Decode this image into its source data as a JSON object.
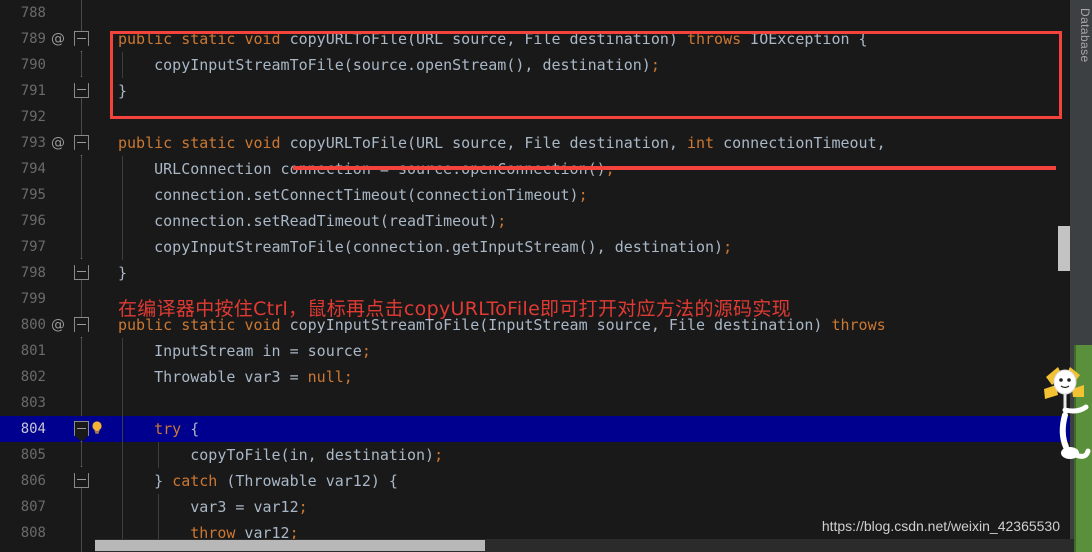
{
  "editor": {
    "app_kind": "java-source-viewer",
    "current_line": 804,
    "lines": [
      {
        "num": "788",
        "annotation": "",
        "fold": "",
        "indent_guides": 0,
        "tokens": []
      },
      {
        "num": "789",
        "annotation": "@",
        "fold": "down",
        "indent_guides": 0,
        "tokens": [
          {
            "t": "public",
            "c": "k"
          },
          {
            "t": " ",
            "c": "plain"
          },
          {
            "t": "static",
            "c": "k"
          },
          {
            "t": " ",
            "c": "plain"
          },
          {
            "t": "void",
            "c": "k"
          },
          {
            "t": " ",
            "c": "plain"
          },
          {
            "t": "copyURLToFile(URL source, File destination) ",
            "c": "id"
          },
          {
            "t": "throws",
            "c": "k"
          },
          {
            "t": " ",
            "c": "plain"
          },
          {
            "t": "IOException {",
            "c": "id"
          }
        ]
      },
      {
        "num": "790",
        "annotation": "",
        "fold": "",
        "indent_guides": 1,
        "tokens": [
          {
            "t": "    copyInputStreamToFile(source.openStream(), destination)",
            "c": "id"
          },
          {
            "t": ";",
            "c": "p"
          }
        ]
      },
      {
        "num": "791",
        "annotation": "",
        "fold": "up",
        "indent_guides": 0,
        "tokens": [
          {
            "t": "}",
            "c": "id"
          }
        ]
      },
      {
        "num": "792",
        "annotation": "",
        "fold": "",
        "indent_guides": 0,
        "tokens": []
      },
      {
        "num": "793",
        "annotation": "@",
        "fold": "down",
        "indent_guides": 0,
        "tokens": [
          {
            "t": "public",
            "c": "k"
          },
          {
            "t": " ",
            "c": "plain"
          },
          {
            "t": "static",
            "c": "k"
          },
          {
            "t": " ",
            "c": "plain"
          },
          {
            "t": "void",
            "c": "k"
          },
          {
            "t": " ",
            "c": "plain"
          },
          {
            "t": "copyURLToFile(URL source, File destination, ",
            "c": "id"
          },
          {
            "t": "int",
            "c": "k"
          },
          {
            "t": " ",
            "c": "plain"
          },
          {
            "t": "connectionTimeout,",
            "c": "id"
          }
        ]
      },
      {
        "num": "794",
        "annotation": "",
        "fold": "",
        "indent_guides": 1,
        "tokens": [
          {
            "t": "    URLConnection connection = source.openConnection()",
            "c": "id"
          },
          {
            "t": ";",
            "c": "p"
          }
        ]
      },
      {
        "num": "795",
        "annotation": "",
        "fold": "",
        "indent_guides": 1,
        "tokens": [
          {
            "t": "    connection.setConnectTimeout(connectionTimeout)",
            "c": "id"
          },
          {
            "t": ";",
            "c": "p"
          }
        ]
      },
      {
        "num": "796",
        "annotation": "",
        "fold": "",
        "indent_guides": 1,
        "tokens": [
          {
            "t": "    connection.setReadTimeout(readTimeout)",
            "c": "id"
          },
          {
            "t": ";",
            "c": "p"
          }
        ]
      },
      {
        "num": "797",
        "annotation": "",
        "fold": "",
        "indent_guides": 1,
        "tokens": [
          {
            "t": "    copyInputStreamToFile(connection.getInputStream(), destination)",
            "c": "id"
          },
          {
            "t": ";",
            "c": "p"
          }
        ]
      },
      {
        "num": "798",
        "annotation": "",
        "fold": "up",
        "indent_guides": 0,
        "tokens": [
          {
            "t": "}",
            "c": "id"
          }
        ]
      },
      {
        "num": "799",
        "annotation": "",
        "fold": "",
        "indent_guides": 0,
        "tokens": []
      },
      {
        "num": "800",
        "annotation": "@",
        "fold": "down",
        "indent_guides": 0,
        "tokens": [
          {
            "t": "public",
            "c": "k"
          },
          {
            "t": " ",
            "c": "plain"
          },
          {
            "t": "static",
            "c": "k"
          },
          {
            "t": " ",
            "c": "plain"
          },
          {
            "t": "void",
            "c": "k"
          },
          {
            "t": " ",
            "c": "plain"
          },
          {
            "t": "copyInputStreamToFile(InputStream source, File destination) ",
            "c": "id"
          },
          {
            "t": "throws",
            "c": "k"
          }
        ]
      },
      {
        "num": "801",
        "annotation": "",
        "fold": "",
        "indent_guides": 1,
        "tokens": [
          {
            "t": "    InputStream in = source",
            "c": "id"
          },
          {
            "t": ";",
            "c": "p"
          }
        ]
      },
      {
        "num": "802",
        "annotation": "",
        "fold": "",
        "indent_guides": 1,
        "tokens": [
          {
            "t": "    Throwable var3 = ",
            "c": "id"
          },
          {
            "t": "null",
            "c": "k"
          },
          {
            "t": ";",
            "c": "p"
          }
        ]
      },
      {
        "num": "803",
        "annotation": "",
        "fold": "",
        "indent_guides": 1,
        "tokens": []
      },
      {
        "num": "804",
        "annotation": "",
        "fold": "down",
        "indent_guides": 1,
        "bulb": true,
        "tokens": [
          {
            "t": "    ",
            "c": "plain"
          },
          {
            "t": "try",
            "c": "k"
          },
          {
            "t": " {",
            "c": "id"
          }
        ]
      },
      {
        "num": "805",
        "annotation": "",
        "fold": "",
        "indent_guides": 2,
        "tokens": [
          {
            "t": "        copyToFile(in, destination)",
            "c": "id"
          },
          {
            "t": ";",
            "c": "p"
          }
        ]
      },
      {
        "num": "806",
        "annotation": "",
        "fold": "up",
        "indent_guides": 1,
        "tokens": [
          {
            "t": "    } ",
            "c": "id"
          },
          {
            "t": "catch",
            "c": "k"
          },
          {
            "t": " (Throwable var12) {",
            "c": "id"
          }
        ]
      },
      {
        "num": "807",
        "annotation": "",
        "fold": "",
        "indent_guides": 2,
        "tokens": [
          {
            "t": "        var3 = var12",
            "c": "id"
          },
          {
            "t": ";",
            "c": "p"
          }
        ]
      },
      {
        "num": "808",
        "annotation": "",
        "fold": "",
        "indent_guides": 2,
        "tokens": [
          {
            "t": "        ",
            "c": "plain"
          },
          {
            "t": "throw",
            "c": "k"
          },
          {
            "t": " var12",
            "c": "id"
          },
          {
            "t": ";",
            "c": "p"
          }
        ]
      }
    ]
  },
  "annotation_note": {
    "text": "在编译器中按住Ctrl，鼠标再点击copyURLToFile即可打开对应方法的源码实现",
    "color": "#e03a33"
  },
  "highlights": {
    "red_box_color": "#f4433c",
    "red_underline_color": "#f4433c",
    "current_line_color": "#00008f"
  },
  "right_panel": {
    "database_tab_label": "Database"
  },
  "watermark": {
    "text": "https://blog.csdn.net/weixin_42365530"
  },
  "icons": {
    "annotation_marker": "@",
    "bulb": "lightbulb-icon",
    "fold_down": "fold-collapse-icon",
    "fold_up": "fold-end-icon"
  }
}
